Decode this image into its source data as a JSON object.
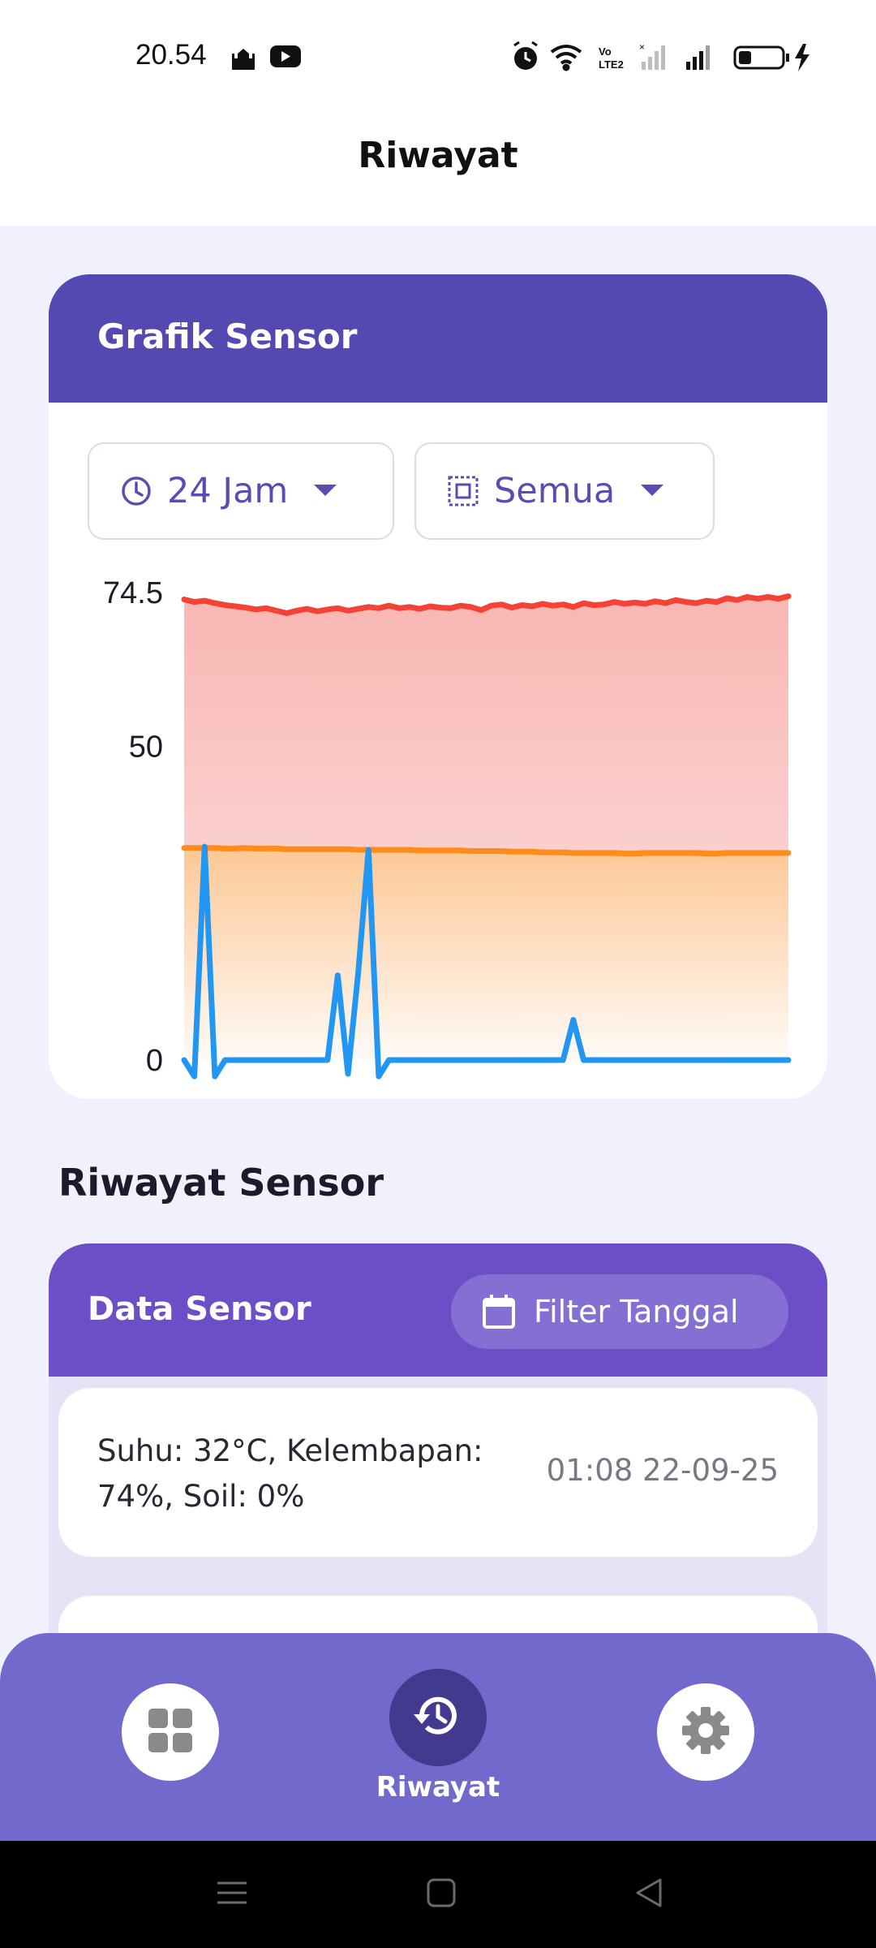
{
  "status_bar": {
    "time": "20.54",
    "left_icons": [
      "mosque-icon",
      "youtube-icon"
    ],
    "right_icons": [
      "alarm-icon",
      "wifi-icon",
      "volte-icon",
      "signal-weak-icon",
      "signal-icon",
      "battery-icon",
      "charging-icon"
    ],
    "battery_level": 0.3
  },
  "app_bar": {
    "title": "Riwayat"
  },
  "chart_card": {
    "title": "Grafik Sensor",
    "time_range": {
      "icon": "clock-icon",
      "label": "24 Jam"
    },
    "sensor_filter": {
      "icon": "sensor-icon",
      "label": "Semua"
    }
  },
  "chart_data": {
    "type": "area",
    "x_labels_visible": false,
    "ylim": [
      0,
      74.5
    ],
    "y_ticks": [
      {
        "value": 74.5,
        "label": "74.5"
      },
      {
        "value": 50,
        "label": "50"
      },
      {
        "value": 0,
        "label": "0"
      }
    ],
    "grid": false,
    "legend": "none",
    "x_count": 60,
    "series": [
      {
        "color": "#f44336",
        "fill": "#f8b7b3",
        "values": [
          73.4,
          73.0,
          73.2,
          72.8,
          72.5,
          72.3,
          72.1,
          71.8,
          72.0,
          71.6,
          71.2,
          71.6,
          71.9,
          71.5,
          71.8,
          72.0,
          71.6,
          71.9,
          72.2,
          72.0,
          72.4,
          72.0,
          72.2,
          71.9,
          72.3,
          72.1,
          72.0,
          72.4,
          72.2,
          71.7,
          72.4,
          72.6,
          72.1,
          72.5,
          72.3,
          72.7,
          72.4,
          72.6,
          72.2,
          72.8,
          72.5,
          72.6,
          73.0,
          72.7,
          72.9,
          72.7,
          73.1,
          72.8,
          73.3,
          73.0,
          72.8,
          73.2,
          73.0,
          73.6,
          73.3,
          73.8,
          73.5,
          73.8,
          73.5,
          73.9
        ]
      },
      {
        "color": "#ff8c1a",
        "fill": "#fcc896",
        "values": [
          33.8,
          33.8,
          33.8,
          33.8,
          33.7,
          33.7,
          33.8,
          33.7,
          33.7,
          33.7,
          33.6,
          33.6,
          33.6,
          33.6,
          33.6,
          33.6,
          33.6,
          33.5,
          33.5,
          33.5,
          33.5,
          33.5,
          33.5,
          33.4,
          33.4,
          33.4,
          33.4,
          33.4,
          33.3,
          33.3,
          33.3,
          33.3,
          33.2,
          33.2,
          33.2,
          33.1,
          33.1,
          33.1,
          33.0,
          33.0,
          33.0,
          33.0,
          33.0,
          32.9,
          32.9,
          33.0,
          33.0,
          33.0,
          33.0,
          33.0,
          33.0,
          32.9,
          32.9,
          33.0,
          33.0,
          33.0,
          33.0,
          33.0,
          33.0,
          33.0
        ]
      },
      {
        "color": "#2196f3",
        "values": [
          0,
          -2.6,
          34.0,
          -2.6,
          0,
          0,
          0,
          0,
          0,
          0,
          0,
          0,
          0,
          0,
          0,
          13.5,
          -2.2,
          14.0,
          33.5,
          -2.6,
          0,
          0,
          0,
          0,
          0,
          0,
          0,
          0,
          0,
          0,
          0,
          0,
          0,
          0,
          0,
          0,
          0,
          0,
          6.4,
          0,
          0,
          0,
          0,
          0,
          0,
          0,
          0,
          0,
          0,
          0,
          0,
          0,
          0,
          0,
          0,
          0,
          0,
          0,
          0,
          0
        ]
      }
    ]
  },
  "history": {
    "section_title": "Riwayat Sensor",
    "panel_title": "Data Sensor",
    "filter_button": {
      "icon": "calendar-icon",
      "label": "Filter Tanggal"
    },
    "items": [
      {
        "text": "Suhu: 32°C, Kelembapan: 74%, Soil: 0%",
        "time": "01:08 22-09-25"
      },
      {
        "text": "",
        "time": ""
      }
    ]
  },
  "bottom_nav": {
    "items": [
      {
        "icon": "dashboard-icon",
        "label": "",
        "active": false
      },
      {
        "icon": "history-icon",
        "label": "Riwayat",
        "active": true
      },
      {
        "icon": "settings-icon",
        "label": "",
        "active": false
      }
    ]
  },
  "system_nav": [
    "menu-icon",
    "home-icon",
    "back-icon"
  ]
}
